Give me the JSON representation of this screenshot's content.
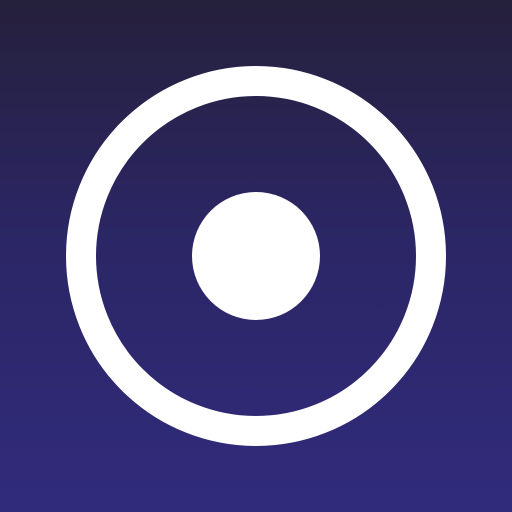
{
  "icon": {
    "name": "record-target-icon",
    "colors": {
      "background_top": "#25203b",
      "background_bottom": "#312b7c",
      "glyph": "#ffffff"
    }
  }
}
